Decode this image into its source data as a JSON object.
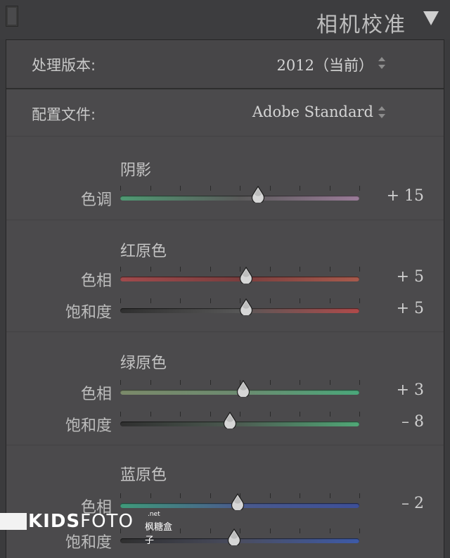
{
  "panel": {
    "title": "相机校准"
  },
  "process": {
    "label": "处理版本:",
    "value": "2012（当前）"
  },
  "profile": {
    "label": "配置文件:",
    "value": "Adobe Standard"
  },
  "sections": [
    {
      "title": "阴影",
      "sliders": [
        {
          "label": "色调",
          "value": "+ 15",
          "level": 0.575,
          "grad": [
            "#4f9a73",
            "#5a5a5a",
            "#9b7c99"
          ]
        }
      ]
    },
    {
      "title": "红原色",
      "sliders": [
        {
          "label": "色相",
          "value": "+ 5",
          "level": 0.525,
          "grad": [
            "#a14a4c",
            "#7a3e3e",
            "#a85a4c"
          ]
        },
        {
          "label": "饱和度",
          "value": "+ 5",
          "level": 0.525,
          "grad": [
            "#2f2f2f",
            "#575757",
            "#b04a4a"
          ]
        }
      ]
    },
    {
      "title": "绿原色",
      "sliders": [
        {
          "label": "色相",
          "value": "+ 3",
          "level": 0.515,
          "grad": [
            "#7b8a6a",
            "#6c8b70",
            "#4aa77a"
          ]
        },
        {
          "label": "饱和度",
          "value": "– 8",
          "level": 0.46,
          "grad": [
            "#2f2f2f",
            "#4d5c52",
            "#50a877"
          ]
        }
      ]
    },
    {
      "title": "蓝原色",
      "sliders": [
        {
          "label": "色相",
          "value": "– 2",
          "level": 0.49,
          "grad": [
            "#3f9a7a",
            "#4a5a8c",
            "#3d4f98"
          ]
        },
        {
          "label": "饱和度",
          "value": "",
          "level": 0.475,
          "grad": [
            "#2f2f2f",
            "#4a4d60",
            "#3d5aa8"
          ]
        }
      ]
    }
  ],
  "watermark": {
    "kids": "KIDS",
    "foto": "FOTO",
    "net": ".net",
    "cn": "枫糖盒子"
  }
}
